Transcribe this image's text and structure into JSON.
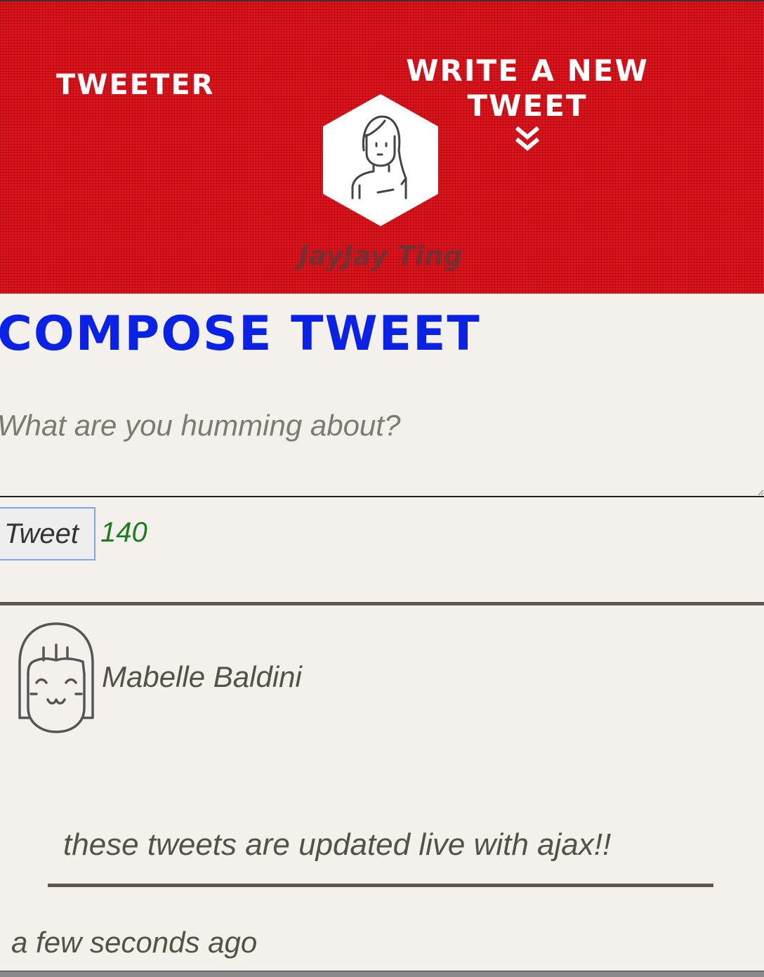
{
  "nav": {
    "brand": "TWEETER",
    "compose_toggle_label": "WRITE A NEW TWEET",
    "compose_toggle_icon": "double-chevron-down-icon"
  },
  "profile": {
    "name": "JayJay Ting",
    "avatar_icon": "user-avatar-icon"
  },
  "compose": {
    "title": "COMPOSE TWEET",
    "placeholder": "What are you humming about?",
    "value": "",
    "submit_label": "Tweet",
    "remaining_chars": "140"
  },
  "tweets": [
    {
      "author": "Mabelle Baldini",
      "avatar_icon": "user-avatar-icon",
      "content": "these tweets are updated live with ajax!!",
      "time": "a few seconds ago"
    }
  ],
  "colors": {
    "header_bg": "#e5111b",
    "title_blue": "#0a22e6",
    "counter_green": "#1e7a1e",
    "page_bg": "#f4f1ec"
  }
}
